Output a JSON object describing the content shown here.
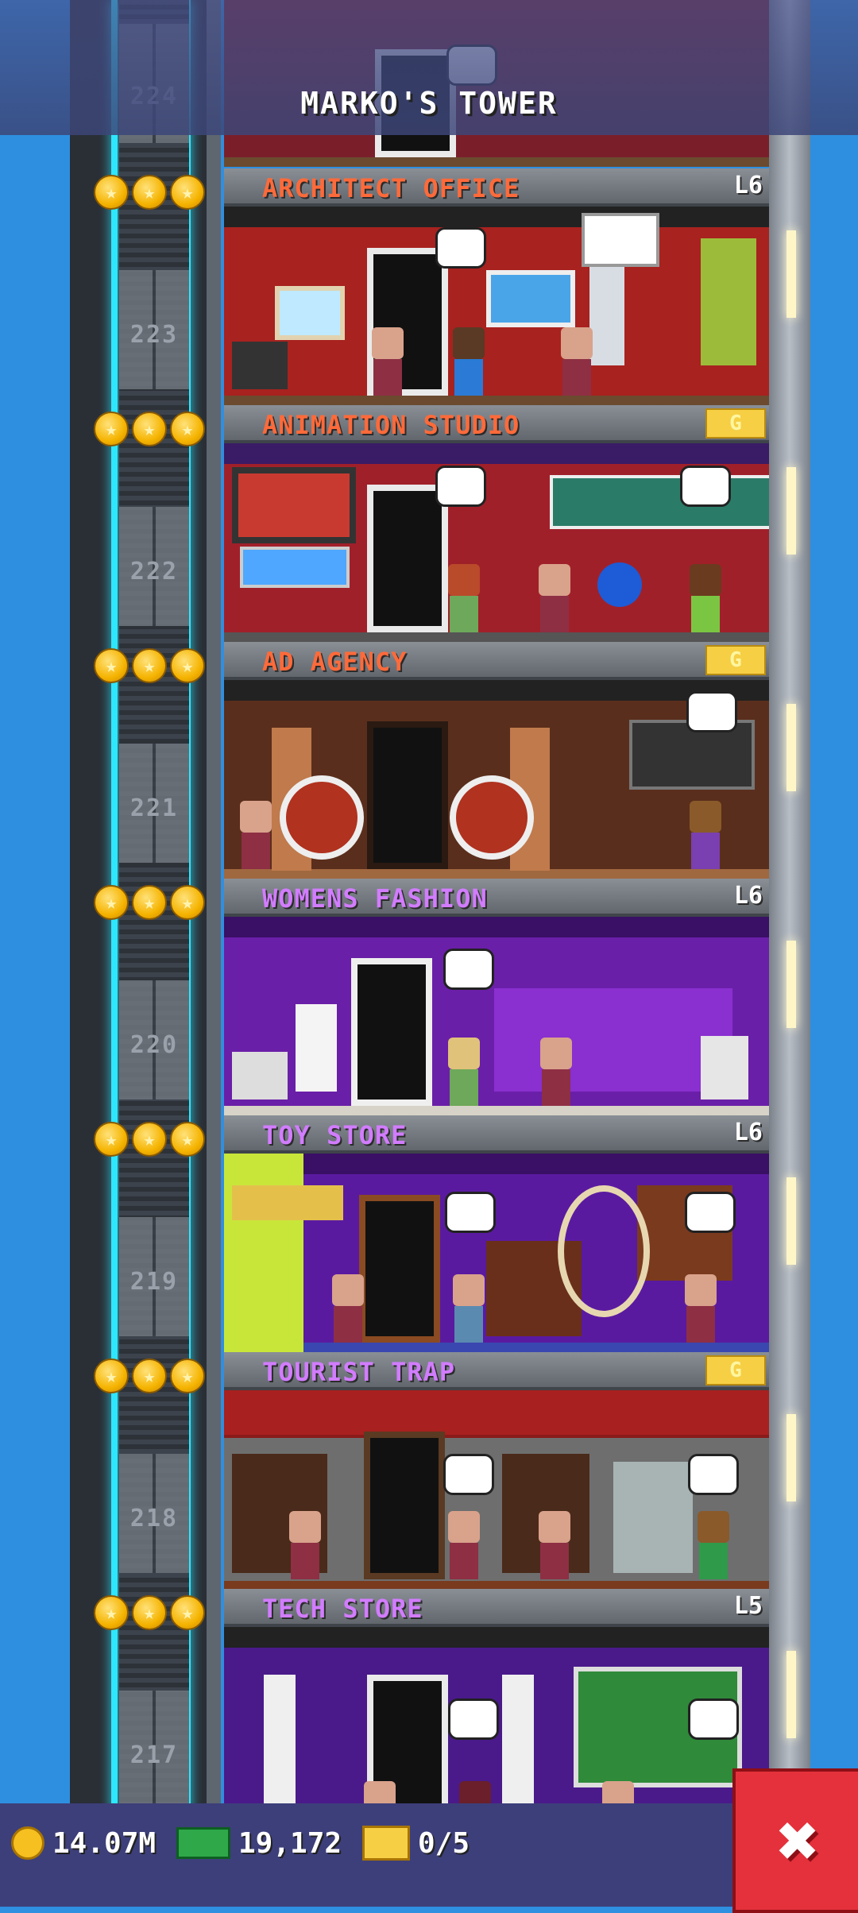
{
  "tower": {
    "title": "MARKO'S TOWER"
  },
  "floors": [
    {
      "number": "224",
      "name": "",
      "level": ""
    },
    {
      "number": "223",
      "name": "ARCHITECT OFFICE",
      "level": "L6",
      "color": "#ff6a3a"
    },
    {
      "number": "222",
      "name": "ANIMATION STUDIO",
      "level": "G",
      "color": "#ff6a3a"
    },
    {
      "number": "221",
      "name": "AD AGENCY",
      "level": "G",
      "color": "#ff6a3a"
    },
    {
      "number": "220",
      "name": "WOMENS FASHION",
      "level": "L6",
      "color": "#d27cff"
    },
    {
      "number": "219",
      "name": "TOY STORE",
      "level": "L6",
      "color": "#d27cff"
    },
    {
      "number": "218",
      "name": "TOURIST TRAP",
      "level": "G",
      "color": "#d27cff"
    },
    {
      "number": "217",
      "name": "TECH STORE",
      "level": "L5",
      "color": "#d27cff"
    }
  ],
  "resources": {
    "coins": "14.07M",
    "tower_bux": "19,172",
    "tickets": "0/5"
  },
  "close_button": {
    "label": "✖"
  },
  "colors": {
    "sky": "#2f8fe0",
    "shaft_light": "#2fe6ff",
    "close_bg": "#e4313b",
    "bar_bg": "#3d3f7a"
  }
}
